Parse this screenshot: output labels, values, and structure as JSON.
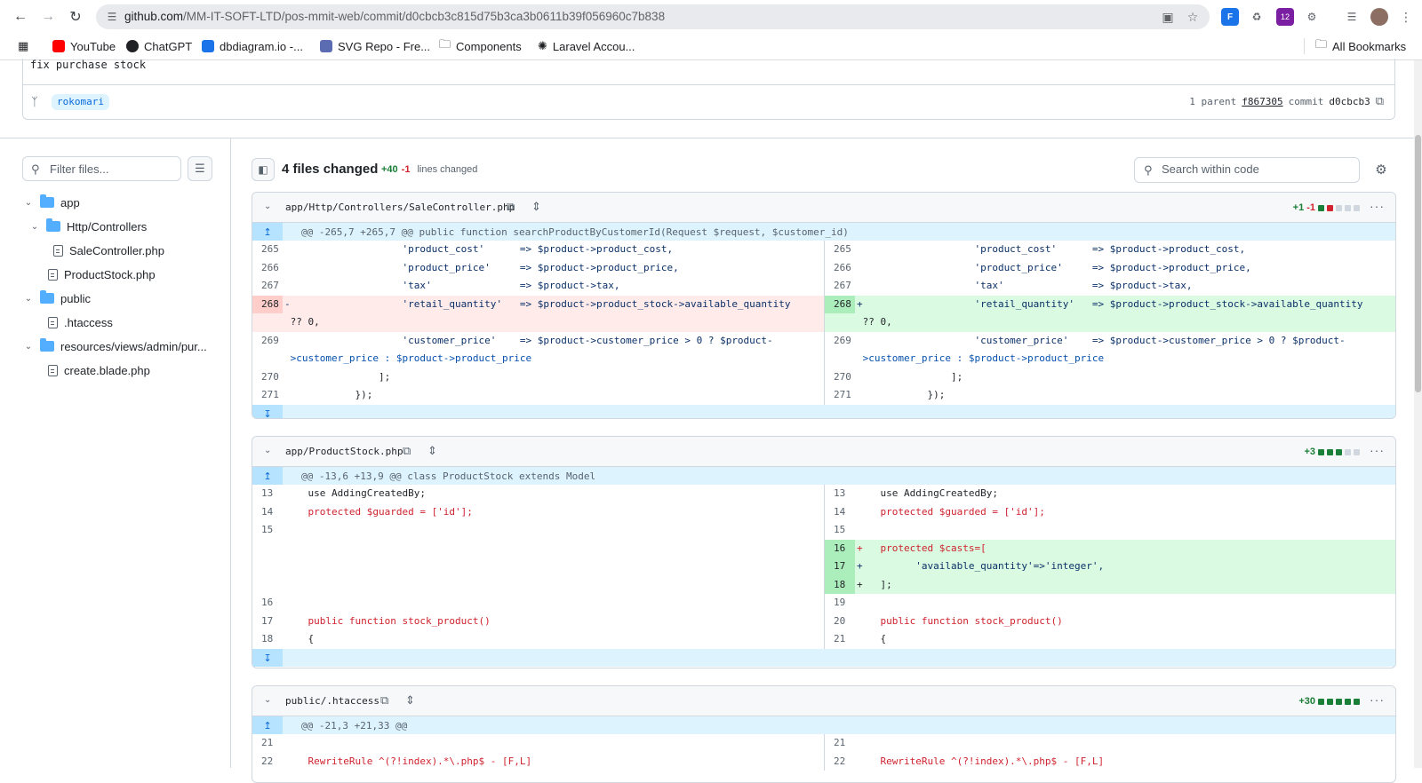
{
  "browser": {
    "url_host": "github.com",
    "url_path": "/MM-IT-SOFT-LTD/pos-mmit-web/commit/d0cbcb3c815d75b3ca3b0611b39f056960c7b838",
    "extension_badge": "12",
    "bookmarks": [
      {
        "label": "YouTube",
        "icon_color": "#ff0000"
      },
      {
        "label": "ChatGPT",
        "icon_color": "#202124"
      },
      {
        "label": "dbdiagram.io -...",
        "icon_color": "#1a73e8"
      },
      {
        "label": "SVG Repo - Fre...",
        "icon_color": "#5b6cb2"
      },
      {
        "label": "Components",
        "icon_color": "#5f6368"
      },
      {
        "label": "Laravel Accou...",
        "icon_color": "#5f6368"
      }
    ],
    "all_bookmarks": "All Bookmarks"
  },
  "commit": {
    "message": "fix purchase stock",
    "branch": "rokomari",
    "parent_label": "1 parent",
    "parent_sha": "f867305",
    "commit_label": "commit",
    "commit_sha": "d0cbcb3"
  },
  "sidebar": {
    "filter_placeholder": "Filter files...",
    "tree": [
      {
        "label": "app",
        "type": "folder"
      },
      {
        "label": "Http/Controllers",
        "type": "folder"
      },
      {
        "label": "SaleController.php",
        "type": "file"
      },
      {
        "label": "ProductStock.php",
        "type": "file"
      },
      {
        "label": "public",
        "type": "folder"
      },
      {
        "label": ".htaccess",
        "type": "file"
      },
      {
        "label": "resources/views/admin/pur...",
        "type": "folder"
      },
      {
        "label": "create.blade.php",
        "type": "file"
      }
    ]
  },
  "summary": {
    "files_changed": "4 files changed",
    "additions": "+40",
    "deletions": "-1",
    "lines_label": "lines changed",
    "search_placeholder": "Search within code"
  },
  "diffs": [
    {
      "name": "app/Http/Controllers/SaleController.php",
      "add": "+1",
      "del": "-1",
      "hunk": "@@ -265,7 +265,7 @@ public function searchProductByCustomerId(Request $request, $customer_id)",
      "left": [
        {
          "ln": "265",
          "code": "                    'product_cost'      => $product->product_cost,"
        },
        {
          "ln": "266",
          "code": "                    'product_price'     => $product->product_price,"
        },
        {
          "ln": "267",
          "code": "                    'tax'               => $product->tax,"
        },
        {
          "ln": "268",
          "code": "-                   'retail_quantity'   => $product->product_stock->available_quantity"
        },
        {
          "ln": "",
          "code": " ?? 0,"
        },
        {
          "ln": "269",
          "code": "                    'customer_price'    => $product->customer_price > 0 ? $product-"
        },
        {
          "ln": "",
          "code": " >customer_price : $product->product_price"
        },
        {
          "ln": "270",
          "code": "                ];"
        },
        {
          "ln": "271",
          "code": "            });"
        }
      ],
      "right": [
        {
          "ln": "265",
          "code": "                    'product_cost'      => $product->product_cost,"
        },
        {
          "ln": "266",
          "code": "                    'product_price'     => $product->product_price,"
        },
        {
          "ln": "267",
          "code": "                    'tax'               => $product->tax,"
        },
        {
          "ln": "268",
          "code": "+                   'retail_quantity'   => $product->product_stock->available_quantity"
        },
        {
          "ln": "",
          "code": " ?? 0,"
        },
        {
          "ln": "269",
          "code": "                    'customer_price'    => $product->customer_price > 0 ? $product-"
        },
        {
          "ln": "",
          "code": " >customer_price : $product->product_price"
        },
        {
          "ln": "270",
          "code": "                ];"
        },
        {
          "ln": "271",
          "code": "            });"
        }
      ]
    },
    {
      "name": "app/ProductStock.php",
      "add": "+3",
      "hunk": "@@ -13,6 +13,9 @@ class ProductStock extends Model",
      "left": [
        {
          "ln": "13",
          "code": "    use AddingCreatedBy;"
        },
        {
          "ln": "14",
          "code": "    protected $guarded = ['id'];"
        },
        {
          "ln": "15",
          "code": ""
        },
        {
          "ln": "",
          "code": ""
        },
        {
          "ln": "",
          "code": ""
        },
        {
          "ln": "",
          "code": ""
        },
        {
          "ln": "16",
          "code": ""
        },
        {
          "ln": "17",
          "code": "    public function stock_product()"
        },
        {
          "ln": "18",
          "code": "    {"
        }
      ],
      "right": [
        {
          "ln": "13",
          "code": "    use AddingCreatedBy;"
        },
        {
          "ln": "14",
          "code": "    protected $guarded = ['id'];"
        },
        {
          "ln": "15",
          "code": ""
        },
        {
          "ln": "16",
          "code": "+   protected $casts=["
        },
        {
          "ln": "17",
          "code": "+         'available_quantity'=>'integer',"
        },
        {
          "ln": "18",
          "code": "+   ];"
        },
        {
          "ln": "19",
          "code": ""
        },
        {
          "ln": "20",
          "code": "    public function stock_product()"
        },
        {
          "ln": "21",
          "code": "    {"
        }
      ]
    },
    {
      "name": "public/.htaccess",
      "add": "+30",
      "hunk": "@@ -21,3 +21,33 @@",
      "left": [
        {
          "ln": "21",
          "code": ""
        },
        {
          "ln": "22",
          "code": "    RewriteRule ^(?!index).*\\.php$ - [F,L]"
        }
      ],
      "right": [
        {
          "ln": "21",
          "code": ""
        },
        {
          "ln": "22",
          "code": "    RewriteRule ^(?!index).*\\.php$ - [F,L]"
        }
      ]
    }
  ]
}
